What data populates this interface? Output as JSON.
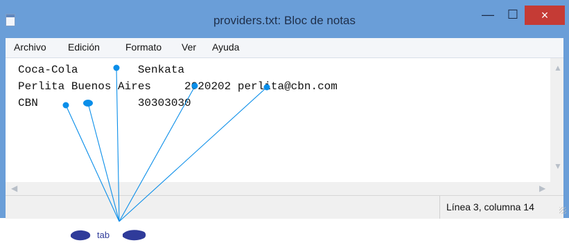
{
  "window": {
    "title": "providers.txt: Bloc de notas",
    "buttons": {
      "minimize": "—",
      "maximize": "☐",
      "close": "×"
    }
  },
  "menu": [
    "Archivo",
    "Edición",
    "Formato",
    "Ver",
    "Ayuda"
  ],
  "editor": {
    "lines": [
      "Coca-Cola         Senkata",
      "Perlita Buenos Aires     2020202 perlita@cbn.com",
      "CBN               30303030"
    ]
  },
  "status": {
    "position": "Línea 3, columna 14"
  },
  "annotation": {
    "label": "tab"
  },
  "colors": {
    "accent": "#0a8ee9",
    "annotation_dark": "#2f3b9a",
    "title_bar": "#6a9ed8",
    "close_button": "#c53b35"
  }
}
